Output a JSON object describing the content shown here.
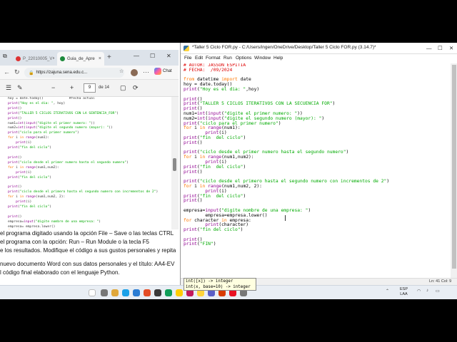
{
  "browser": {
    "tabs": [
      {
        "label": "P_22010005_V",
        "active": false
      },
      {
        "label": "Guia_de_Apre",
        "active": true
      }
    ],
    "url": "https://zajuna.sena.edu.c...",
    "chat_label": "Chat",
    "page_current": "9",
    "page_count": "de 14",
    "code_lines": [
      "hoy = date.today()             #fecha actual",
      "print(\"Hoy es el dia: \", hoy)",
      "print()",
      "print(\"TALLER 5 CICLOS ITERATIVOS CON LA SENTENCIA_FOR\")",
      "print()",
      "num1=int(input(\"digite el primer numero: \"))",
      "num2=int(input(\"digite el segundo numero (mayor): \"))",
      "print(\"ciclo para el primer numero\")",
      "for i in range(num1):",
      "    print(i)",
      "print(\"fin del ciclo\")",
      "",
      "print()",
      "print(\"ciclo desde el primer numero hasta el segundo numero\")",
      "for i in range(num1,num2):",
      "    print(i)",
      "print(\"fin del ciclo\")",
      "",
      "print()",
      "print(\"ciclo desde el primero hasta el segundo numero con incrementos de 2\")",
      "for i in range(num1,num2, 2):",
      "    print(i)",
      "print(\"fin del ciclo\")",
      "",
      "print()",
      "empresa=input(\"digite nombre de una empresa: \")",
      "empresa= empresa.lower()",
      "for character in empresa:",
      "    print(character)",
      "print(\"fin del ciclo\")",
      "",
      "print()",
      "print(\"FIN\")"
    ],
    "text_lines": [
      "el programa digitado usando la opción File – Save o las teclas CTRL",
      "el programa con la opción: Run – Run Module   o la tecla F5",
      "e los resultados. Modifique el código a sus gustos personales y repita",
      "",
      " nuevo documento Word con sus datos personales y el título: AA4-EV",
      "l código final elaborado con el lenguaje Python."
    ]
  },
  "idle": {
    "title": "*Taller 5 Ciclo FOR.py - C:/Users/ingen/OneDrive/Desktop/Taller 5 Ciclo FOR.py (3.14.7)*",
    "menu": [
      "File",
      "Edit",
      "Format",
      "Run",
      "Options",
      "Window",
      "Help"
    ],
    "code_lines": [
      "# AUTOR: JASSON ESPITIA",
      "# FECHA:  /09/2024",
      "",
      "from datetime import date",
      "hoy = date.today()",
      "print(\"Hoy es el dia: \",hoy)",
      "",
      "print()",
      "print(\"TALLER 5 CICLOS ITERATIVOS CON LA SECUENCIA FOR\")",
      "print()",
      "num1=int(input(\"digite el primer numero: \"))",
      "num2=int(input(\"digite el segundo numero (mayor): \")",
      "print(\"ciclo para el primer numero\")",
      "for i in range(num1):",
      "        print(i)",
      "print(\"fin  del ciclo\")",
      "print()",
      "",
      "print(\"ciclo desde el primer numero hasta el segundo numero\")",
      "for i in range(num1,num2):",
      "        print(i)",
      "print(\"fin  del ciclo\")",
      "print()",
      "",
      "print(\"ciclo desde el primero hasta el segundo numero con incrementos de 2\")",
      "for i in range(num1,num2, 2):",
      "        print(i)",
      "print(\"fin  del ciclo\")",
      "print()",
      "",
      "empresa=input(\"digite nombre de una empresa: \")",
      "        empresa=empresa.lower()",
      "for character in empresa:",
      "        print(character)",
      "print(\"fin del ciclo\")",
      "",
      "print()",
      "print(\"FIN\")"
    ],
    "calltip": [
      "int([x]) -> integer",
      "int(x, base=10) -> integer"
    ],
    "status": "Ln: 41   Col: 9"
  },
  "taskbar": {
    "lang_top": "ESP",
    "lang_bottom": "LAA"
  },
  "colors": {
    "keyword": "#ff7700",
    "builtin": "#900090",
    "string": "#00aa00",
    "comment": "#dd0000"
  }
}
